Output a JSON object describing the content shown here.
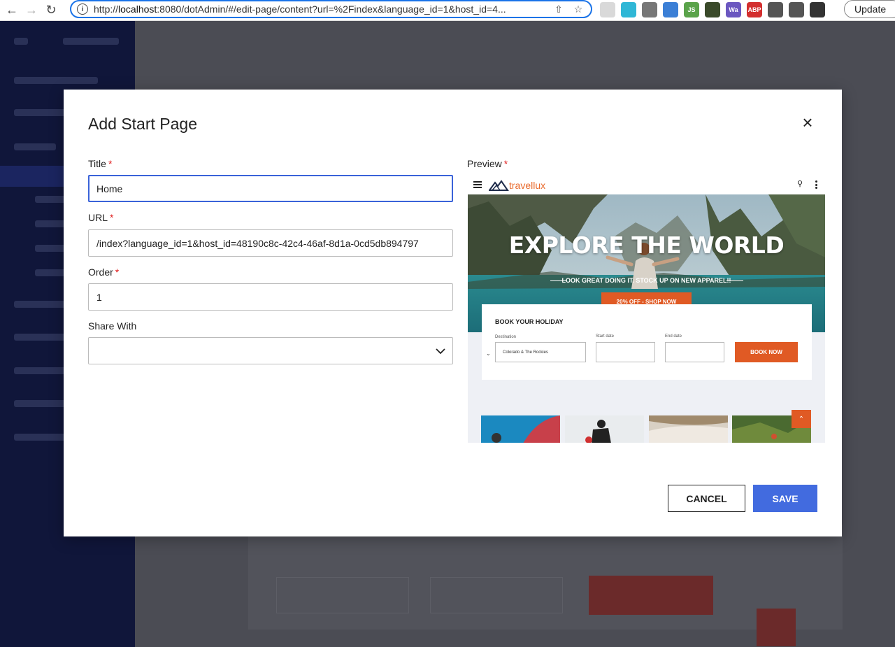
{
  "browser": {
    "url_prefix": "http://",
    "url_host": "localhost",
    "url_rest": ":8080/dotAdmin/#/edit-page/content?url=%2Findex&language_id=1&host_id=4...",
    "update_label": "Update",
    "extensions": [
      {
        "name": "ext-grid-icon",
        "color": "#d9d9d9",
        "label": ""
      },
      {
        "name": "ext-asterisk-icon",
        "color": "#2fb7d6",
        "label": ""
      },
      {
        "name": "ext-camera-icon",
        "color": "#777777",
        "label": ""
      },
      {
        "name": "ext-green-icon",
        "color": "#3b7fd6",
        "label": ""
      },
      {
        "name": "ext-js-icon",
        "color": "#5aa34a",
        "label": "JS"
      },
      {
        "name": "ext-globe-icon",
        "color": "#3a4a2a",
        "label": ""
      },
      {
        "name": "ext-wa-icon",
        "color": "#6b57c0",
        "label": "Wa"
      },
      {
        "name": "ext-abp-icon",
        "color": "#d32f2f",
        "label": "ABP"
      },
      {
        "name": "puzzle-icon",
        "color": "#555555",
        "label": ""
      },
      {
        "name": "sidebar-toggle-icon",
        "color": "#555555",
        "label": ""
      },
      {
        "name": "profile-avatar-icon",
        "color": "#333333",
        "label": ""
      }
    ]
  },
  "modal": {
    "title": "Add Start Page",
    "close_icon": "×",
    "title_label": "Title",
    "title_value": "Home",
    "url_label": "URL",
    "url_value": "/index?language_id=1&host_id=48190c8c-42c4-46af-8d1a-0cd5db894797",
    "order_label": "Order",
    "order_value": "1",
    "share_label": "Share With",
    "share_value": "",
    "preview_label": "Preview",
    "required_mark": "*",
    "cancel_label": "CANCEL",
    "save_label": "SAVE"
  },
  "preview": {
    "logo_text": "travellux",
    "hero_title": "EXPLORE THE WORLD",
    "hero_subtitle": "LOOK GREAT DOING IT. STOCK UP ON NEW APPAREL!!",
    "hero_button": "20% OFF - SHOP NOW",
    "book_title": "BOOK YOUR HOLIDAY",
    "destination_label": "Destination",
    "destination_value": "Colorado & The Rockies",
    "start_label": "Start date",
    "end_label": "End date",
    "book_button": "BOOK NOW"
  },
  "colors": {
    "accent": "#426bdf",
    "brand_orange": "#e05a24",
    "required": "#e02020"
  }
}
